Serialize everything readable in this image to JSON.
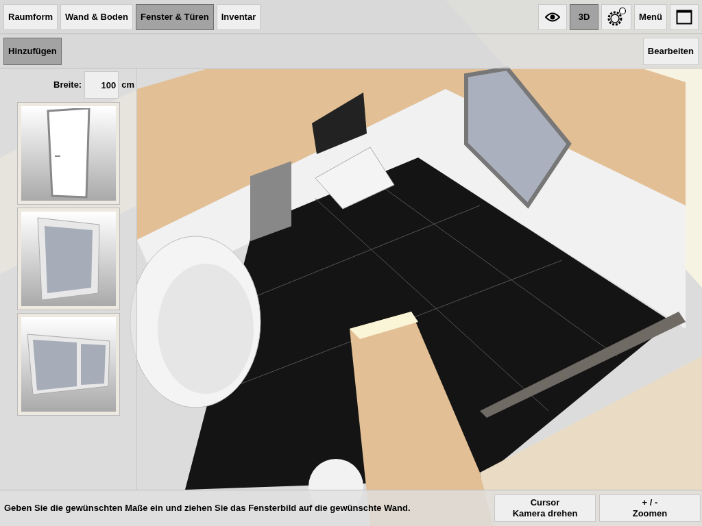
{
  "tabs": [
    {
      "label": "Raumform",
      "selected": false
    },
    {
      "label": "Wand & Boden",
      "selected": false
    },
    {
      "label": "Fenster & Türen",
      "selected": true
    },
    {
      "label": "Inventar",
      "selected": false
    }
  ],
  "view_buttons": [
    {
      "kind": "eye",
      "selected": false
    },
    {
      "kind": "text",
      "label": "3D",
      "selected": true
    },
    {
      "kind": "gears",
      "selected": false
    },
    {
      "kind": "text",
      "label": "Menü",
      "selected": false
    },
    {
      "kind": "window",
      "selected": false
    }
  ],
  "add_button": {
    "label": "Hinzufügen",
    "selected": true
  },
  "edit_button": {
    "label": "Bearbeiten"
  },
  "width_field": {
    "label": "Breite:",
    "value": "100",
    "unit": "cm"
  },
  "catalog": [
    {
      "kind": "door"
    },
    {
      "kind": "window"
    },
    {
      "kind": "double"
    }
  ],
  "status_text": "Geben Sie die gewünschten Maße ein und ziehen Sie das Fensterbild auf die gewünschte Wand.",
  "controls": [
    {
      "lines": [
        "Cursor",
        "Kamera drehen"
      ]
    },
    {
      "lines": [
        "+ / -",
        "Zoomen"
      ]
    }
  ]
}
